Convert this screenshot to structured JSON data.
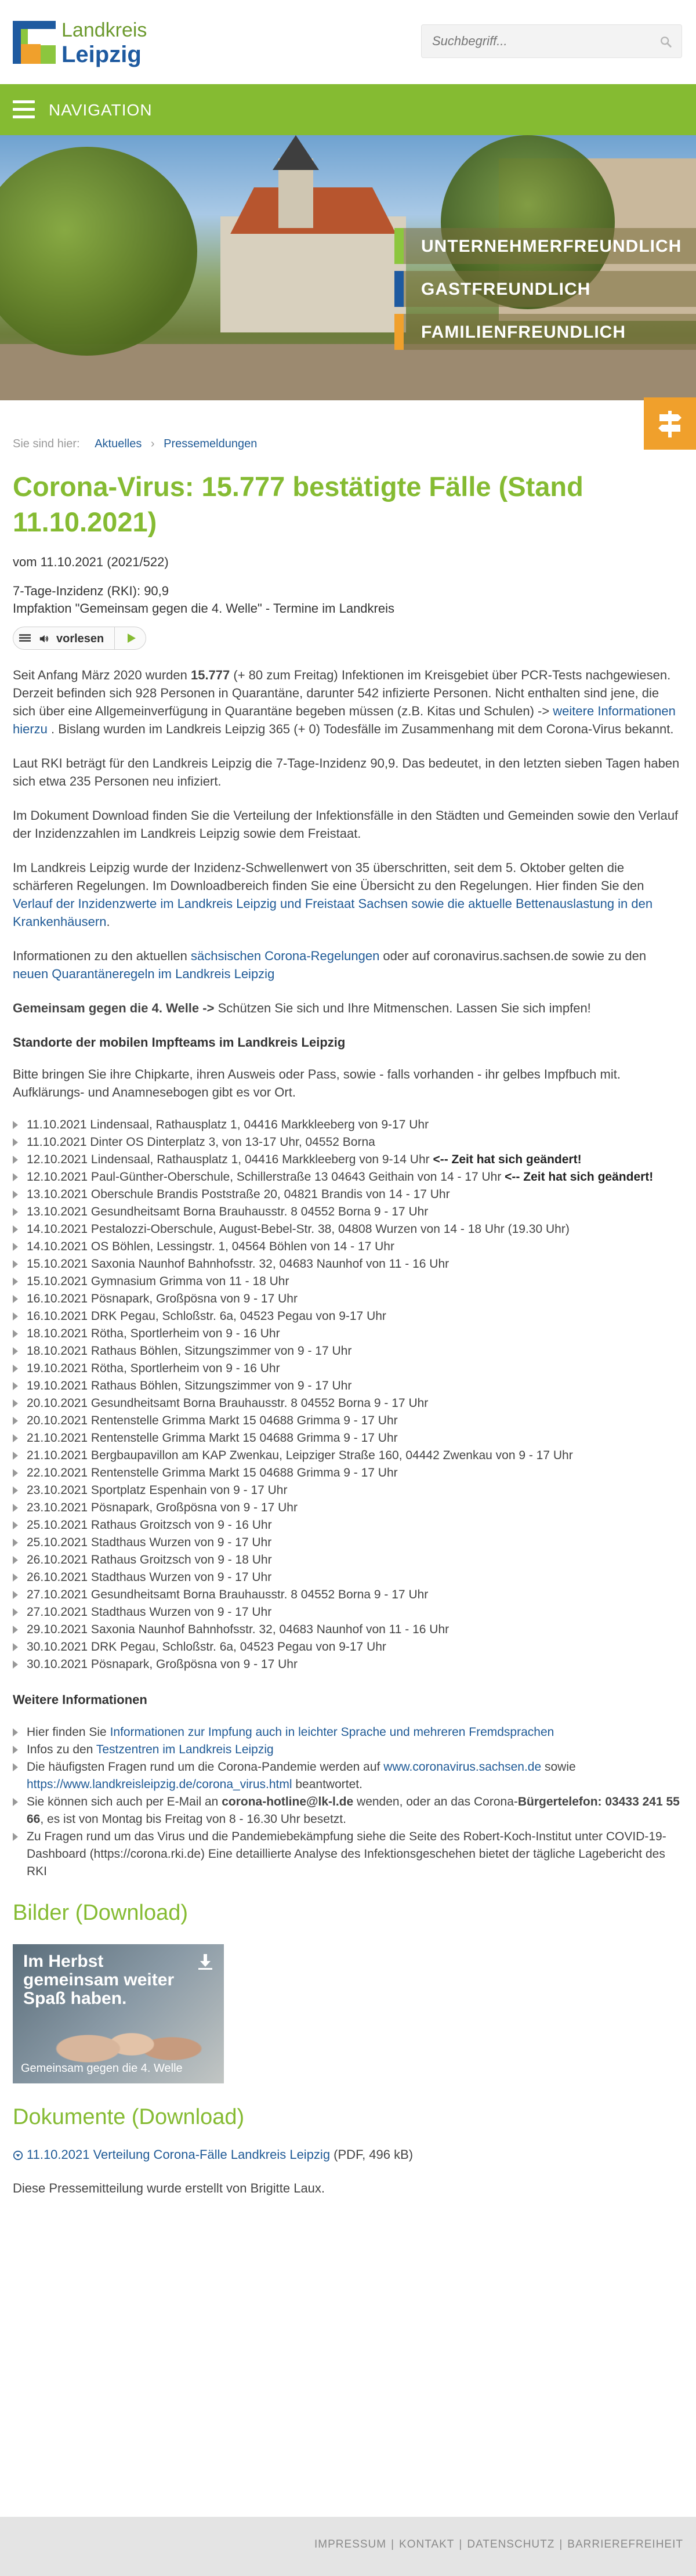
{
  "header": {
    "logo_line1": "Landkreis",
    "logo_line2": "Leipzig",
    "search_placeholder": "Suchbegriff..."
  },
  "nav": {
    "label": "NAVIGATION"
  },
  "hero": {
    "labels": [
      {
        "text": "UNTERNEHMERFREUNDLICH",
        "color": "#8cc63e"
      },
      {
        "text": "GASTFREUNDLICH",
        "color": "#1e5aa0"
      },
      {
        "text": "FAMILIENFREUNDLICH",
        "color": "#f0a02c"
      }
    ]
  },
  "breadcrumb": {
    "prefix": "Sie sind hier:",
    "items": [
      "Aktuelles",
      "Pressemeldungen"
    ]
  },
  "article": {
    "title": "Corona-Virus: 15.777 bestätigte Fälle (Stand 11.10.2021)",
    "meta": "vom 11.10.2021 (2021/522)",
    "sub1": "7-Tage-Inzidenz (RKI): 90,9",
    "sub2": "Impfaktion \"Gemeinsam gegen die 4. Welle\" - Termine im Landkreis",
    "readspeaker_label": "vorlesen",
    "p1_a": "Seit Anfang März 2020 wurden ",
    "p1_b": "15.777",
    "p1_c": " (+ 80 zum Freitag) Infektionen im Kreisgebiet über PCR-Tests nachgewiesen. Derzeit befinden sich 928 Personen in Quarantäne, darunter 542 infizierte Personen. Nicht enthalten sind jene, die sich über eine Allgemeinverfügung in Quarantäne begeben müssen (z.B. Kitas und Schulen) -> ",
    "p1_link": "weitere Informationen hierzu",
    "p1_d": " . Bislang wurden im Landkreis Leipzig 365 (+ 0) Todesfälle im Zusammenhang mit dem Corona-Virus bekannt.",
    "p2": "Laut RKI beträgt für den Landkreis Leipzig die 7-Tage-Inzidenz 90,9. Das bedeutet, in den letzten sieben Tagen haben sich etwa 235 Personen neu infiziert.",
    "p3": "Im Dokument Download finden Sie die Verteilung der Infektionsfälle in den Städten und Gemeinden sowie den Verlauf der Inzidenzzahlen im Landkreis Leipzig sowie dem Freistaat.",
    "p4_a": "Im Landkreis Leipzig wurde der Inzidenz-Schwellenwert von 35 überschritten, seit dem 5. Oktober gelten die schärferen Regelungen. Im Downloadbereich finden Sie eine Übersicht zu den Regelungen. Hier finden Sie den ",
    "p4_link": "Verlauf der Inzidenzwerte im Landkreis Leipzig und Freistaat Sachsen sowie die aktuelle Bettenauslastung in den Krankenhäusern",
    "p4_b": ".",
    "p5_a": "Informationen zu den aktuellen ",
    "p5_link1": "sächsischen Corona-Regelungen",
    "p5_b": " oder auf coronavirus.sachsen.de sowie zu den ",
    "p5_link2": "neuen Quarantäneregeln im Landkreis Leipzig",
    "p6_bold": "Gemeinsam gegen die 4. Welle ->",
    "p6_rest": " Schützen Sie sich und Ihre Mitmenschen. Lassen Sie sich impfen!",
    "h_standorte": "Standorte der mobilen Impfteams im Landkreis Leipzig",
    "p7": "Bitte bringen Sie ihre Chipkarte, ihren Ausweis oder Pass, sowie - falls vorhanden - ihr gelbes Impfbuch mit. Aufklärungs- und Anamnesebogen gibt es vor Ort.",
    "termine": [
      {
        "text": "11.10.2021 Lindensaal, Rathausplatz 1, 04416 Markkleeberg von 9-17 Uhr",
        "warn": ""
      },
      {
        "text": "11.10.2021 Dinter OS Dinterplatz 3, von 13-17 Uhr, 04552 Borna",
        "warn": ""
      },
      {
        "text": "12.10.2021 Lindensaal, Rathausplatz 1, 04416 Markkleeberg von 9-14 Uhr   ",
        "warn": "<-- Zeit hat sich geändert!"
      },
      {
        "text": "12.10.2021 Paul-Günther-Oberschule, Schillerstraße 13 04643 Geithain von 14 - 17 Uhr   ",
        "warn": "<-- Zeit hat sich geändert!"
      },
      {
        "text": "13.10.2021 Oberschule Brandis Poststraße 20, 04821 Brandis von 14 - 17 Uhr",
        "warn": ""
      },
      {
        "text": "13.10.2021 Gesundheitsamt Borna Brauhausstr. 8 04552 Borna 9 - 17 Uhr",
        "warn": ""
      },
      {
        "text": "14.10.2021 Pestalozzi-Oberschule, August-Bebel-Str. 38, 04808 Wurzen von 14 - 18 Uhr (19.30 Uhr)",
        "warn": ""
      },
      {
        "text": "14.10.2021 OS Böhlen, Lessingstr. 1, 04564 Böhlen von 14 - 17 Uhr",
        "warn": ""
      },
      {
        "text": "15.10.2021 Saxonia Naunhof Bahnhofsstr. 32, 04683 Naunhof von 11 - 16 Uhr",
        "warn": ""
      },
      {
        "text": "15.10.2021 Gymnasium Grimma von 11 - 18 Uhr",
        "warn": ""
      },
      {
        "text": "16.10.2021 Pösnapark, Großpösna von 9 - 17 Uhr",
        "warn": ""
      },
      {
        "text": "16.10.2021 DRK Pegau, Schloßstr. 6a, 04523 Pegau von 9-17 Uhr",
        "warn": ""
      },
      {
        "text": "18.10.2021 Rötha, Sportlerheim von 9 - 16 Uhr",
        "warn": ""
      },
      {
        "text": "18.10.2021 Rathaus Böhlen, Sitzungszimmer von 9 - 17 Uhr",
        "warn": ""
      },
      {
        "text": "19.10.2021 Rötha, Sportlerheim von 9 - 16 Uhr",
        "warn": ""
      },
      {
        "text": "19.10.2021 Rathaus Böhlen, Sitzungszimmer von 9 - 17 Uhr",
        "warn": ""
      },
      {
        "text": "20.10.2021 Gesundheitsamt Borna Brauhausstr. 8 04552 Borna 9 - 17 Uhr",
        "warn": ""
      },
      {
        "text": "20.10.2021 Rentenstelle Grimma Markt 15 04688 Grimma 9 - 17 Uhr",
        "warn": ""
      },
      {
        "text": "21.10.2021 Rentenstelle Grimma Markt 15 04688 Grimma 9 - 17 Uhr",
        "warn": ""
      },
      {
        "text": "21.10.2021 Bergbaupavillon am KAP Zwenkau, Leipziger Straße 160, 04442 Zwenkau von 9 - 17 Uhr",
        "warn": ""
      },
      {
        "text": "22.10.2021 Rentenstelle Grimma Markt 15 04688 Grimma 9 - 17 Uhr",
        "warn": ""
      },
      {
        "text": "23.10.2021 Sportplatz Espenhain von 9 - 17 Uhr",
        "warn": ""
      },
      {
        "text": "23.10.2021 Pösnapark, Großpösna von 9 - 17 Uhr",
        "warn": ""
      },
      {
        "text": "25.10.2021 Rathaus Groitzsch von 9 - 16 Uhr",
        "warn": ""
      },
      {
        "text": "25.10.2021 Stadthaus Wurzen von 9 - 17 Uhr",
        "warn": ""
      },
      {
        "text": "26.10.2021 Rathaus Groitzsch von 9 - 18 Uhr",
        "warn": ""
      },
      {
        "text": "26.10.2021 Stadthaus Wurzen von 9 - 17 Uhr",
        "warn": ""
      },
      {
        "text": "27.10.2021 Gesundheitsamt Borna Brauhausstr. 8 04552 Borna 9 - 17 Uhr",
        "warn": ""
      },
      {
        "text": "27.10.2021 Stadthaus Wurzen von 9 - 17 Uhr",
        "warn": ""
      },
      {
        "text": "29.10.2021 Saxonia Naunhof Bahnhofsstr. 32, 04683 Naunhof von 11 - 16 Uhr",
        "warn": ""
      },
      {
        "text": "30.10.2021 DRK Pegau, Schloßstr. 6a, 04523 Pegau von 9-17 Uhr",
        "warn": ""
      },
      {
        "text": "30.10.2021 Pösnapark, Großpösna von 9 - 17 Uhr",
        "warn": ""
      }
    ],
    "h_weitere": "Weitere Informationen",
    "info": {
      "i1_a": "Hier finden Sie ",
      "i1_link": "Informationen zur Impfung auch in leichter Sprache und mehreren Fremdsprachen",
      "i2_a": "Infos zu den ",
      "i2_link": "Testzentren im Landkreis Leipzig",
      "i3_a": "Die häufigsten Fragen rund um die Corona-Pandemie werden auf ",
      "i3_link1": "www.coronavirus.sachsen.de",
      "i3_b": "  sowie ",
      "i3_link2": "https://www.landkreisleipzig.de/corona_virus.html",
      "i3_c": " beantwortet.",
      "i4_a": "Sie können sich auch per E-Mail an ",
      "i4_b1": "corona-hotline@lk-l.de",
      "i4_c": " wenden, oder an das Corona-",
      "i4_b2": "Bürgertelefon: 03433 241 55 66",
      "i4_d": ", es ist von Montag bis Freitag von 8 - 16.30 Uhr besetzt.",
      "i5": "Zu Fragen rund um das Virus und die Pandemiebekämpfung siehe die Seite des Robert-Koch-Institut unter COVID-19-Dashboard (https://corona.rki.de)  Eine detaillierte Analyse des Infektionsgeschehen bietet der tägliche Lagebericht des RKI"
    },
    "h_bilder": "Bilder (Download)",
    "image_headline": "Im Herbst gemeinsam weiter Spaß haben.",
    "image_caption": "Gemeinsam gegen die 4. Welle",
    "h_dokumente": "Dokumente (Download)",
    "doc_link": "11.10.2021 Verteilung Corona-Fälle Landkreis Leipzig",
    "doc_meta": " (PDF, 496 kB)",
    "author": "Diese Pressemitteilung wurde erstellt von Brigitte Laux."
  },
  "footer": {
    "links": [
      "IMPRESSUM",
      "KONTAKT",
      "DATENSCHUTZ",
      "BARRIEREFREIHEIT"
    ],
    "separator": "|"
  }
}
